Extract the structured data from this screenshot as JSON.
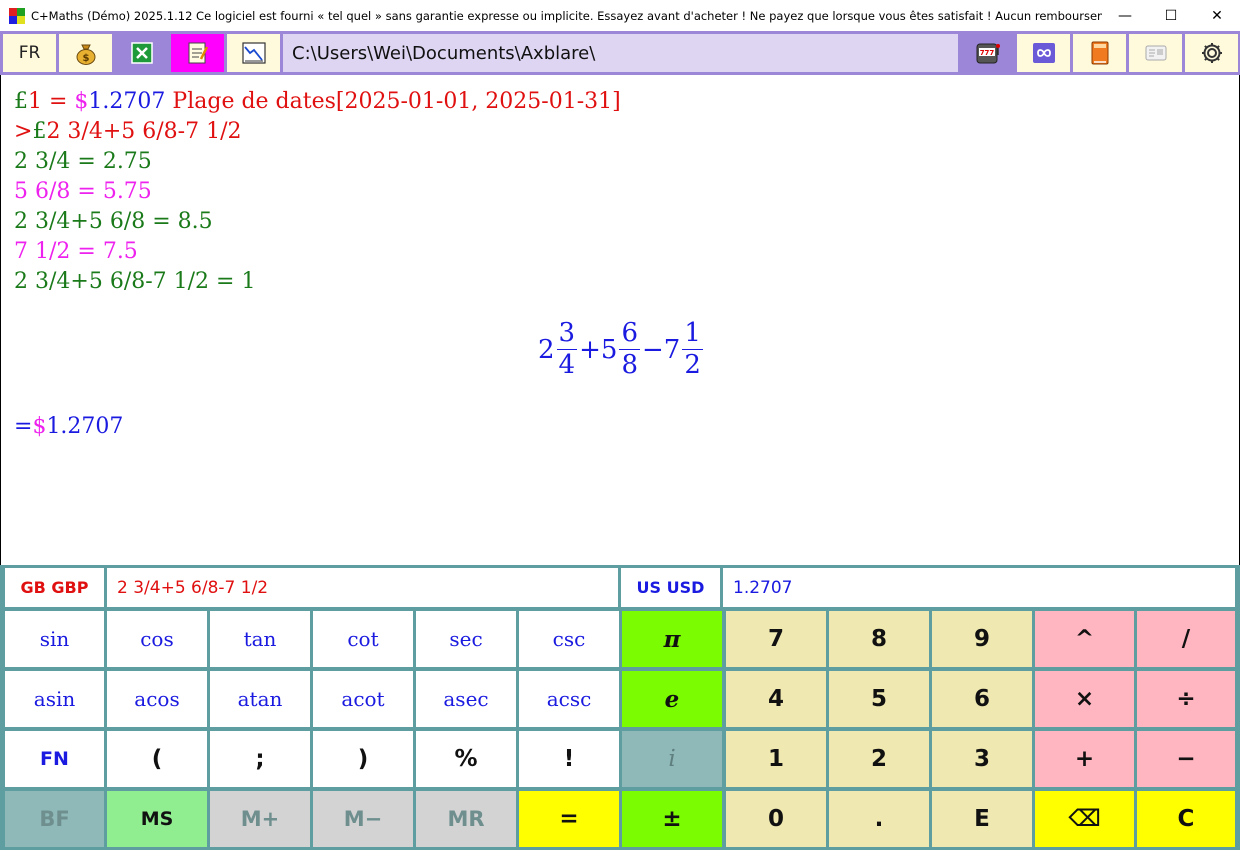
{
  "window": {
    "title": "C+Maths (Démo) 2025.1.12 Ce logiciel est fourni « tel quel » sans garantie expresse ou implicite. Essayez avant d'acheter ! Ne payez que lorsque vous êtes satisfait ! Aucun remboursement !",
    "controls": {
      "minimize": "—",
      "maximize": "☐",
      "close": "✕"
    }
  },
  "toolbar": {
    "language": "FR",
    "money_icon": "money-bag-icon",
    "excel_icon": "excel-icon",
    "notes_icon": "notepad-icon",
    "chart_icon": "line-chart-icon",
    "path": "C:\\Users\\Wei\\Documents\\Axblare\\",
    "right_icons": [
      "slot-machine-icon",
      "infinity-icon",
      "book-icon",
      "id-card-icon",
      "gear-icon"
    ]
  },
  "output": {
    "line1": {
      "currency_symbol": "£",
      "eq": "1 = ",
      "usd_symbol": "$",
      "rate": "1.2707",
      "range": " Plage de dates[2025-01-01, 2025-01-31]"
    },
    "line2": {
      "prompt": ">",
      "currency_symbol": "£",
      "expr": "2 3/4+5 6/8-7 1/2"
    },
    "line3": "2 3/4 = 2.75",
    "line4": "5 6/8 = 5.75",
    "line5": "2 3/4+5 6/8 = 8.5",
    "line6": "7 1/2 = 7.5",
    "line7": "2 3/4+5 6/8-7 1/2 = 1",
    "formula": {
      "w1": "2",
      "n1": "3",
      "d1": "4",
      "op1": "+",
      "w2": "5",
      "n2": "6",
      "d2": "8",
      "op2": "−",
      "w3": "7",
      "n3": "1",
      "d3": "2"
    },
    "result": {
      "eq": "=",
      "usd_symbol": "$",
      "value": "1.2707"
    }
  },
  "converter": {
    "from_label": "GB GBP",
    "from_value": "2 3/4+5 6/8-7 1/2",
    "to_label": "US USD",
    "to_value": "1.2707"
  },
  "keys": {
    "row1": [
      "sin",
      "cos",
      "tan",
      "cot",
      "sec",
      "csc",
      "π",
      "7",
      "8",
      "9",
      "^",
      "/"
    ],
    "row2": [
      "asin",
      "acos",
      "atan",
      "acot",
      "asec",
      "acsc",
      "e",
      "4",
      "5",
      "6",
      "×",
      "÷"
    ],
    "row3": [
      "FN",
      "(",
      ";",
      ")",
      "%",
      "!",
      "i",
      "1",
      "2",
      "3",
      "+",
      "−"
    ],
    "row4": [
      "BF",
      "MS",
      "M+",
      "M−",
      "MR",
      "=",
      "±",
      "0",
      ".",
      "E",
      "⌫",
      "C"
    ]
  },
  "colors": {
    "toolbar": "#9b86d8",
    "path_bg": "#ddd5f2",
    "keypad_border": "#5f9ea0",
    "green": "#7cfc00",
    "tan": "#efe8b0",
    "pink": "#ffb6c1",
    "yellow": "#ffff00"
  }
}
